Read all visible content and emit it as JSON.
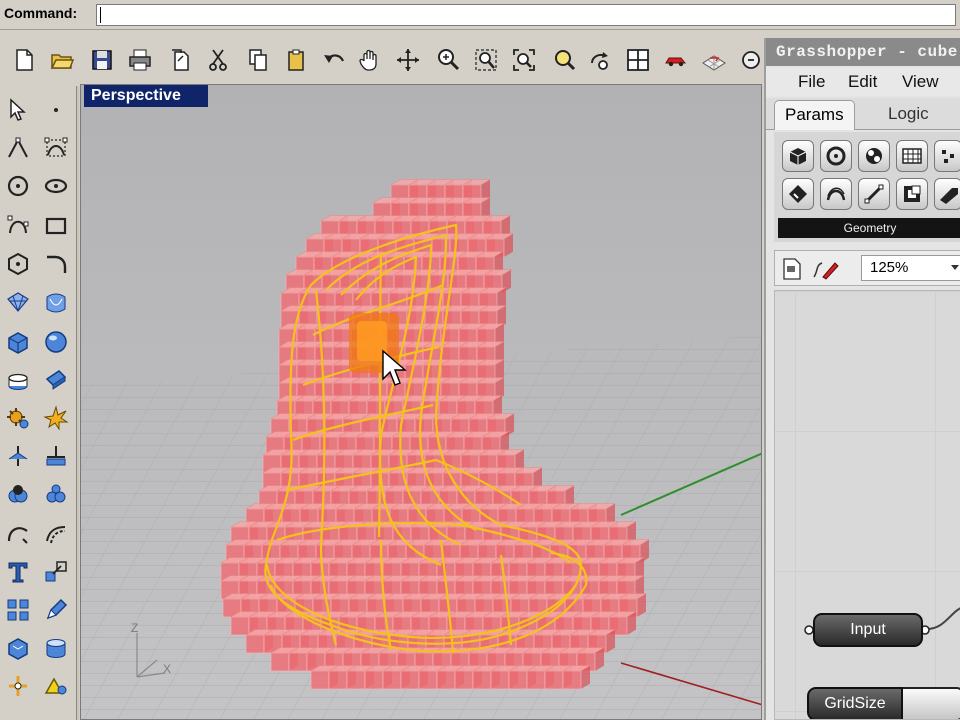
{
  "command_bar": {
    "label": "Command:",
    "value": ""
  },
  "toolbar": {
    "icons": [
      "new-file-icon",
      "open-folder-icon",
      "save-icon",
      "print-icon",
      "paste-template-icon",
      "cut-icon",
      "copy-icon",
      "paste-icon",
      "undo-icon",
      "pan-hand-icon",
      "rotate-view-icon",
      "zoom-icon",
      "zoom-window-icon",
      "zoom-extents-icon",
      "zoom-selected-icon",
      "rotate-camera-icon",
      "four-viewports-icon",
      "render-car-icon",
      "render-grid-icon",
      "options-icon"
    ]
  },
  "viewport": {
    "title": "Perspective",
    "axes": {
      "z": "Z",
      "x": "X"
    }
  },
  "grasshopper": {
    "title": "Grasshopper - cube",
    "menu": [
      "File",
      "Edit",
      "View"
    ],
    "tabs": [
      {
        "label": "Params",
        "active": true
      },
      {
        "label": "Logic",
        "active": false
      }
    ],
    "category": "Geometry",
    "zoom": "125%",
    "nodes": {
      "input": "Input",
      "gridsize": "GridSize"
    }
  }
}
